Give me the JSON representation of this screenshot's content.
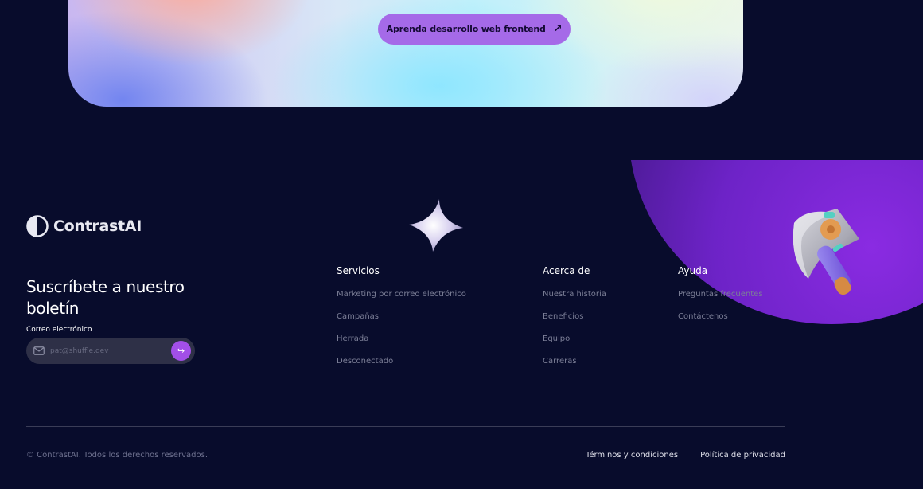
{
  "hero": {
    "cta_label": "Aprenda desarrollo web frontend",
    "cta_icon": "arrow-up-right-icon"
  },
  "brand": {
    "name": "ContrastAI",
    "logo_icon": "half-circle-contrast-icon"
  },
  "newsletter": {
    "title": "Suscríbete a nuestro boletín",
    "email_label": "Correo electrónico",
    "email_placeholder": "pat@shuffle.dev",
    "email_value": "",
    "mail_icon": "mail-icon",
    "submit_icon": "arrow-return-icon"
  },
  "footer": {
    "columns": [
      {
        "title": "Servicios",
        "links": [
          "Marketing por correo electrónico",
          "Campañas",
          "Herrada",
          "Desconectado"
        ]
      },
      {
        "title": "Acerca de",
        "links": [
          "Nuestra historia",
          "Beneficios",
          "Equipo",
          "Carreras"
        ]
      },
      {
        "title": "Ayuda",
        "links": [
          "Preguntas frecuentes",
          "Contáctenos"
        ]
      }
    ],
    "copyright": "© ContrastAI. Todos los derechos reservados.",
    "legal_links": [
      "Términos y condiciones",
      "Política de privacidad"
    ]
  },
  "decor": {
    "star_icon": "sparkle-star-icon",
    "axe_icon": "axe-3d-icon"
  },
  "colors": {
    "background": "#080c2c",
    "accent_purple": "#a56ae8",
    "circle_purple": "#8a2be2"
  }
}
